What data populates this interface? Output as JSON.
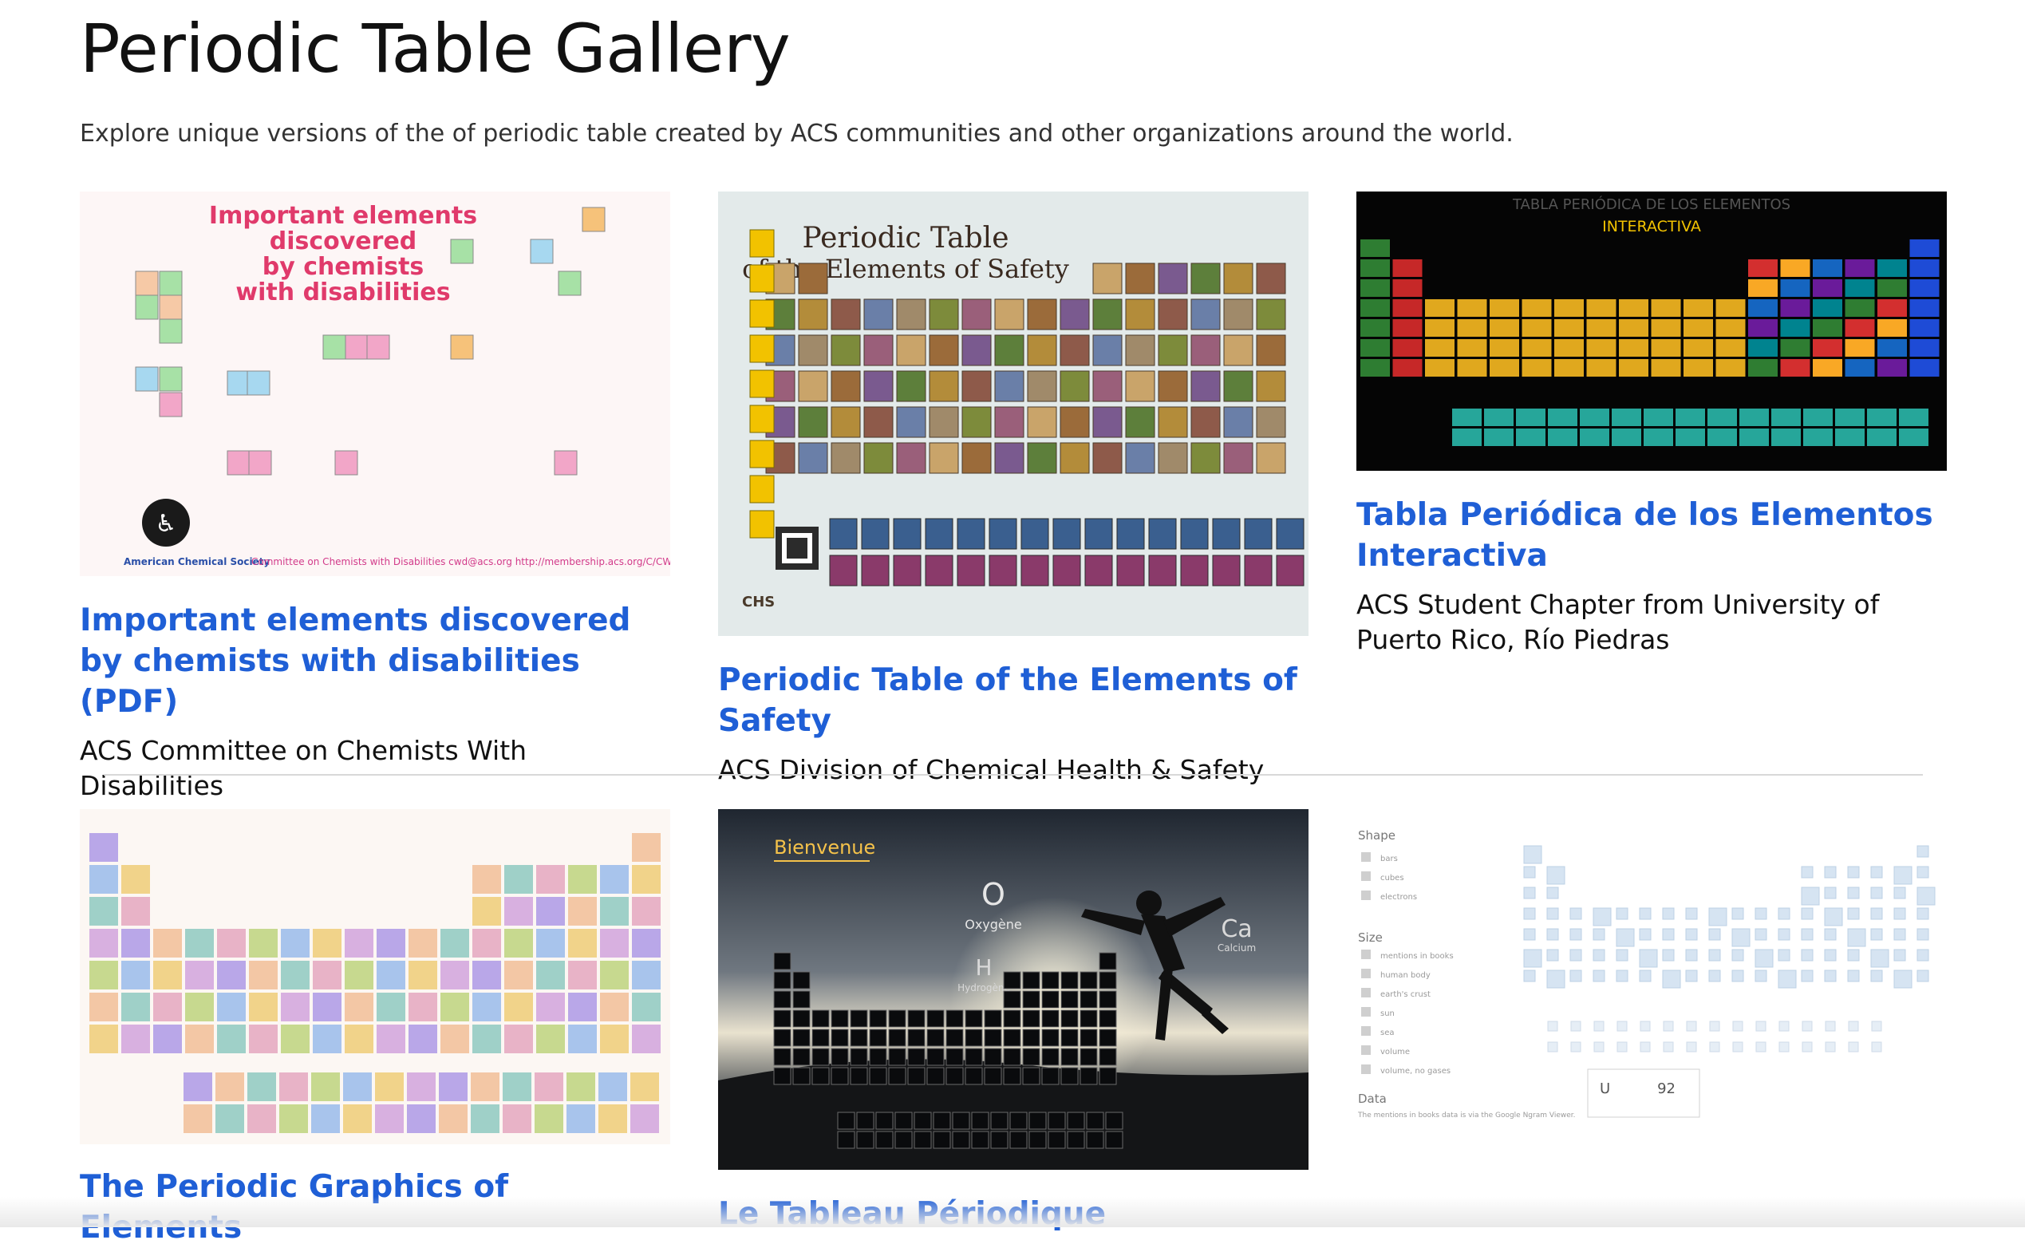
{
  "page": {
    "title": "Periodic Table Gallery",
    "intro": "Explore unique versions of the of periodic table created by ACS communities and other organizations around the world."
  },
  "cards": [
    {
      "title": "Important elements discovered by chemists with disabilities (PDF)",
      "subtitle": "ACS Committee on Chemists With Disabilities",
      "thumb": {
        "heading": "Important elements discovered by chemists with disabilities",
        "footer": "American Chemical Society Committee on Chemists with Disabilities cwd@acs.org http://membership.acs.org/C/CWD",
        "accent": "#e03a6b"
      }
    },
    {
      "title": "Periodic Table of the Elements of Safety",
      "subtitle": "ACS Division of Chemical Health & Safety",
      "thumb": {
        "heading": "Periodic Table of the Elements of Safety",
        "accent": "#5a3d2b"
      }
    },
    {
      "title": "Tabla Periódica de los Elementos Interactiva",
      "subtitle": "ACS Student Chapter from University of Puerto Rico, Río Piedras",
      "thumb": {
        "heading": "TABLA PERIÓDICA DE LOS ELEMENTOS",
        "subheading": "INTERACTIVA",
        "accent": "#f2c200"
      }
    },
    {
      "title": "The Periodic Graphics of Elements",
      "subtitle": "",
      "thumb": {
        "accent": "#7a6ad0"
      }
    },
    {
      "title": "Le Tableau Périodique",
      "subtitle": "",
      "thumb": {
        "heading": "Bienvenue",
        "el1": "Oxygène",
        "el2": "Hydrogène",
        "el3": "Calcium",
        "accent": "#f5c24a"
      }
    },
    {
      "title": "",
      "subtitle": "",
      "thumb": {
        "shape_label": "Shape",
        "shape_options": [
          "bars",
          "cubes",
          "electrons"
        ],
        "size_label": "Size",
        "size_options": [
          "mentions in books",
          "human body",
          "earth's crust",
          "sun",
          "sea",
          "volume",
          "volume, no gases"
        ],
        "data_label": "Data",
        "data_note": "The mentions in books data is via the Google Ngram Viewer.",
        "element_symbol": "U",
        "element_value": "92"
      }
    }
  ],
  "colors": {
    "link": "#1f5fd6",
    "text": "#111111",
    "divider": "#d8d8d8"
  }
}
